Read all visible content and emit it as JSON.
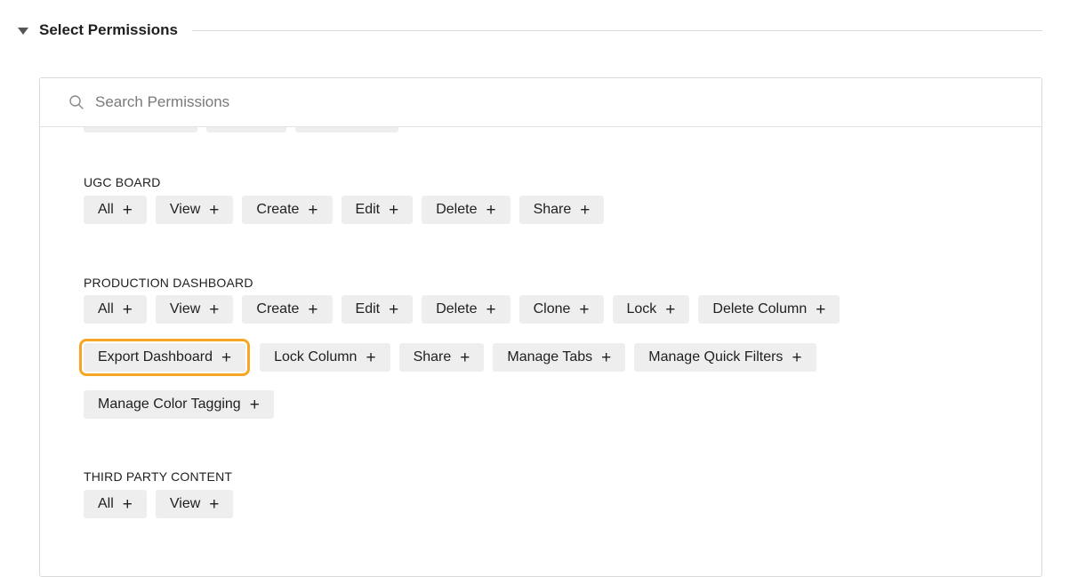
{
  "section": {
    "title": "Select Permissions"
  },
  "search": {
    "placeholder": "Search Permissions"
  },
  "groups": [
    {
      "label": "UGC BOARD",
      "chips": [
        "All",
        "View",
        "Create",
        "Edit",
        "Delete",
        "Share"
      ]
    },
    {
      "label": "PRODUCTION DASHBOARD",
      "rows": [
        [
          "All",
          "View",
          "Create",
          "Edit",
          "Delete",
          "Clone",
          "Lock",
          "Delete Column"
        ],
        [
          "Export Dashboard",
          "Lock Column",
          "Share",
          "Manage Tabs",
          "Manage Quick Filters"
        ],
        [
          "Manage Color Tagging"
        ]
      ]
    },
    {
      "label": "THIRD PARTY CONTENT",
      "chips": [
        "All",
        "View"
      ]
    }
  ],
  "chip_action_icon": "plus-icon",
  "highlight_color": "#f5a623"
}
